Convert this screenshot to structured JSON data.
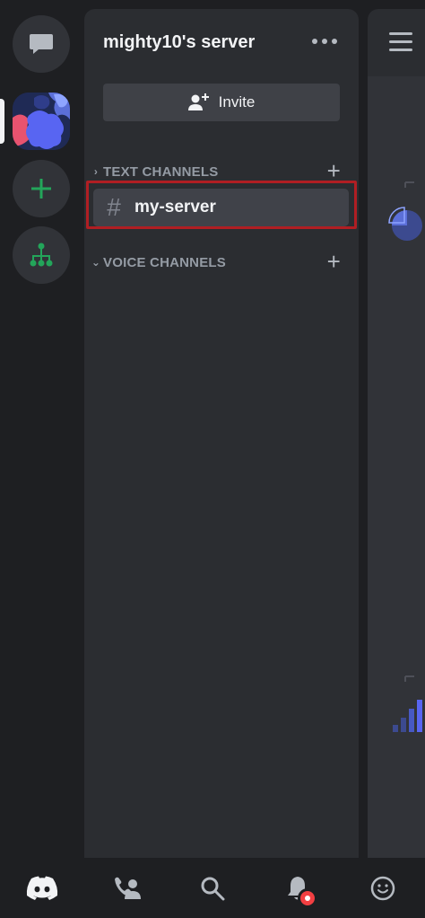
{
  "server": {
    "name": "mighty10's server",
    "invite_label": "Invite"
  },
  "categories": {
    "text": {
      "label": "TEXT CHANNELS"
    },
    "voice": {
      "label": "VOICE CHANNELS"
    }
  },
  "channels": [
    {
      "name": "my-server",
      "type": "text",
      "selected": true
    }
  ],
  "icons": {
    "rail": [
      "direct-messages-icon",
      "server-avatar",
      "add-server-icon",
      "explore-servers-icon"
    ],
    "bottom_nav": [
      "home-icon",
      "friends-icon",
      "search-icon",
      "notifications-icon",
      "profile-icon"
    ]
  },
  "colors": {
    "accent_green": "#23a55a",
    "highlight_red": "#b01e23",
    "notification_red": "#f23f42"
  }
}
